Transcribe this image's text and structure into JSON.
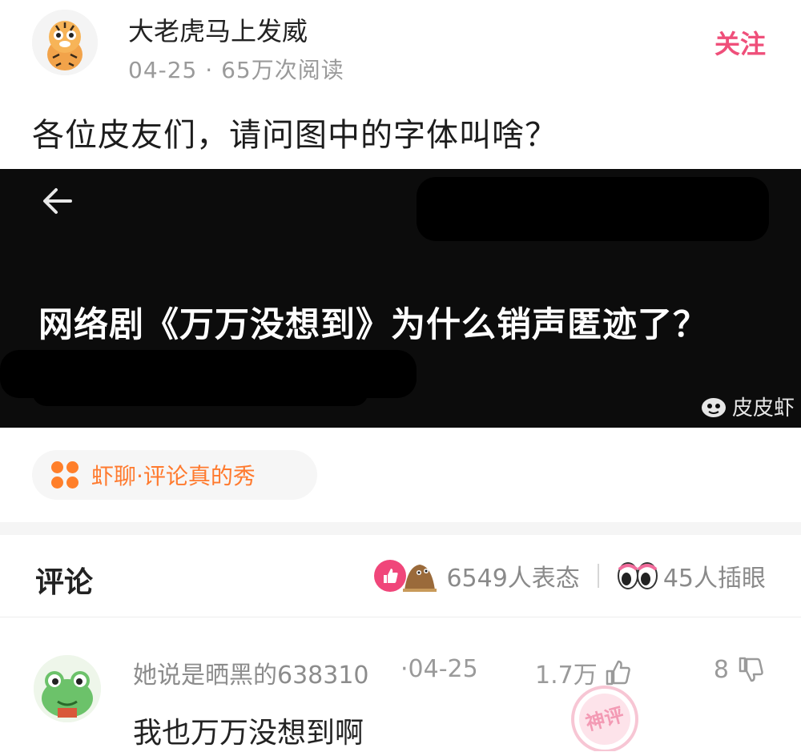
{
  "post": {
    "author": "大老虎马上发威",
    "meta": "04-25 · 65万次阅读",
    "follow_label": "关注",
    "title": "各位皮友们，请问图中的字体叫啥？"
  },
  "image": {
    "headline": "网络剧《万万没想到》为什么销声匿迹了？",
    "watermark": "皮皮虾"
  },
  "topic": {
    "label": "虾聊·评论真的秀"
  },
  "comments_header": {
    "title": "评论",
    "reactions": "6549人表态",
    "views": "45人插眼"
  },
  "comment": {
    "user": "她说是晒黑的638310",
    "date": "·04-25",
    "likes": "1.7万",
    "dislikes": "8",
    "text": "我也万万没想到啊",
    "stamp": "神评"
  },
  "colors": {
    "accent_pink": "#ef4f7a",
    "accent_orange": "#ff7a2e"
  }
}
